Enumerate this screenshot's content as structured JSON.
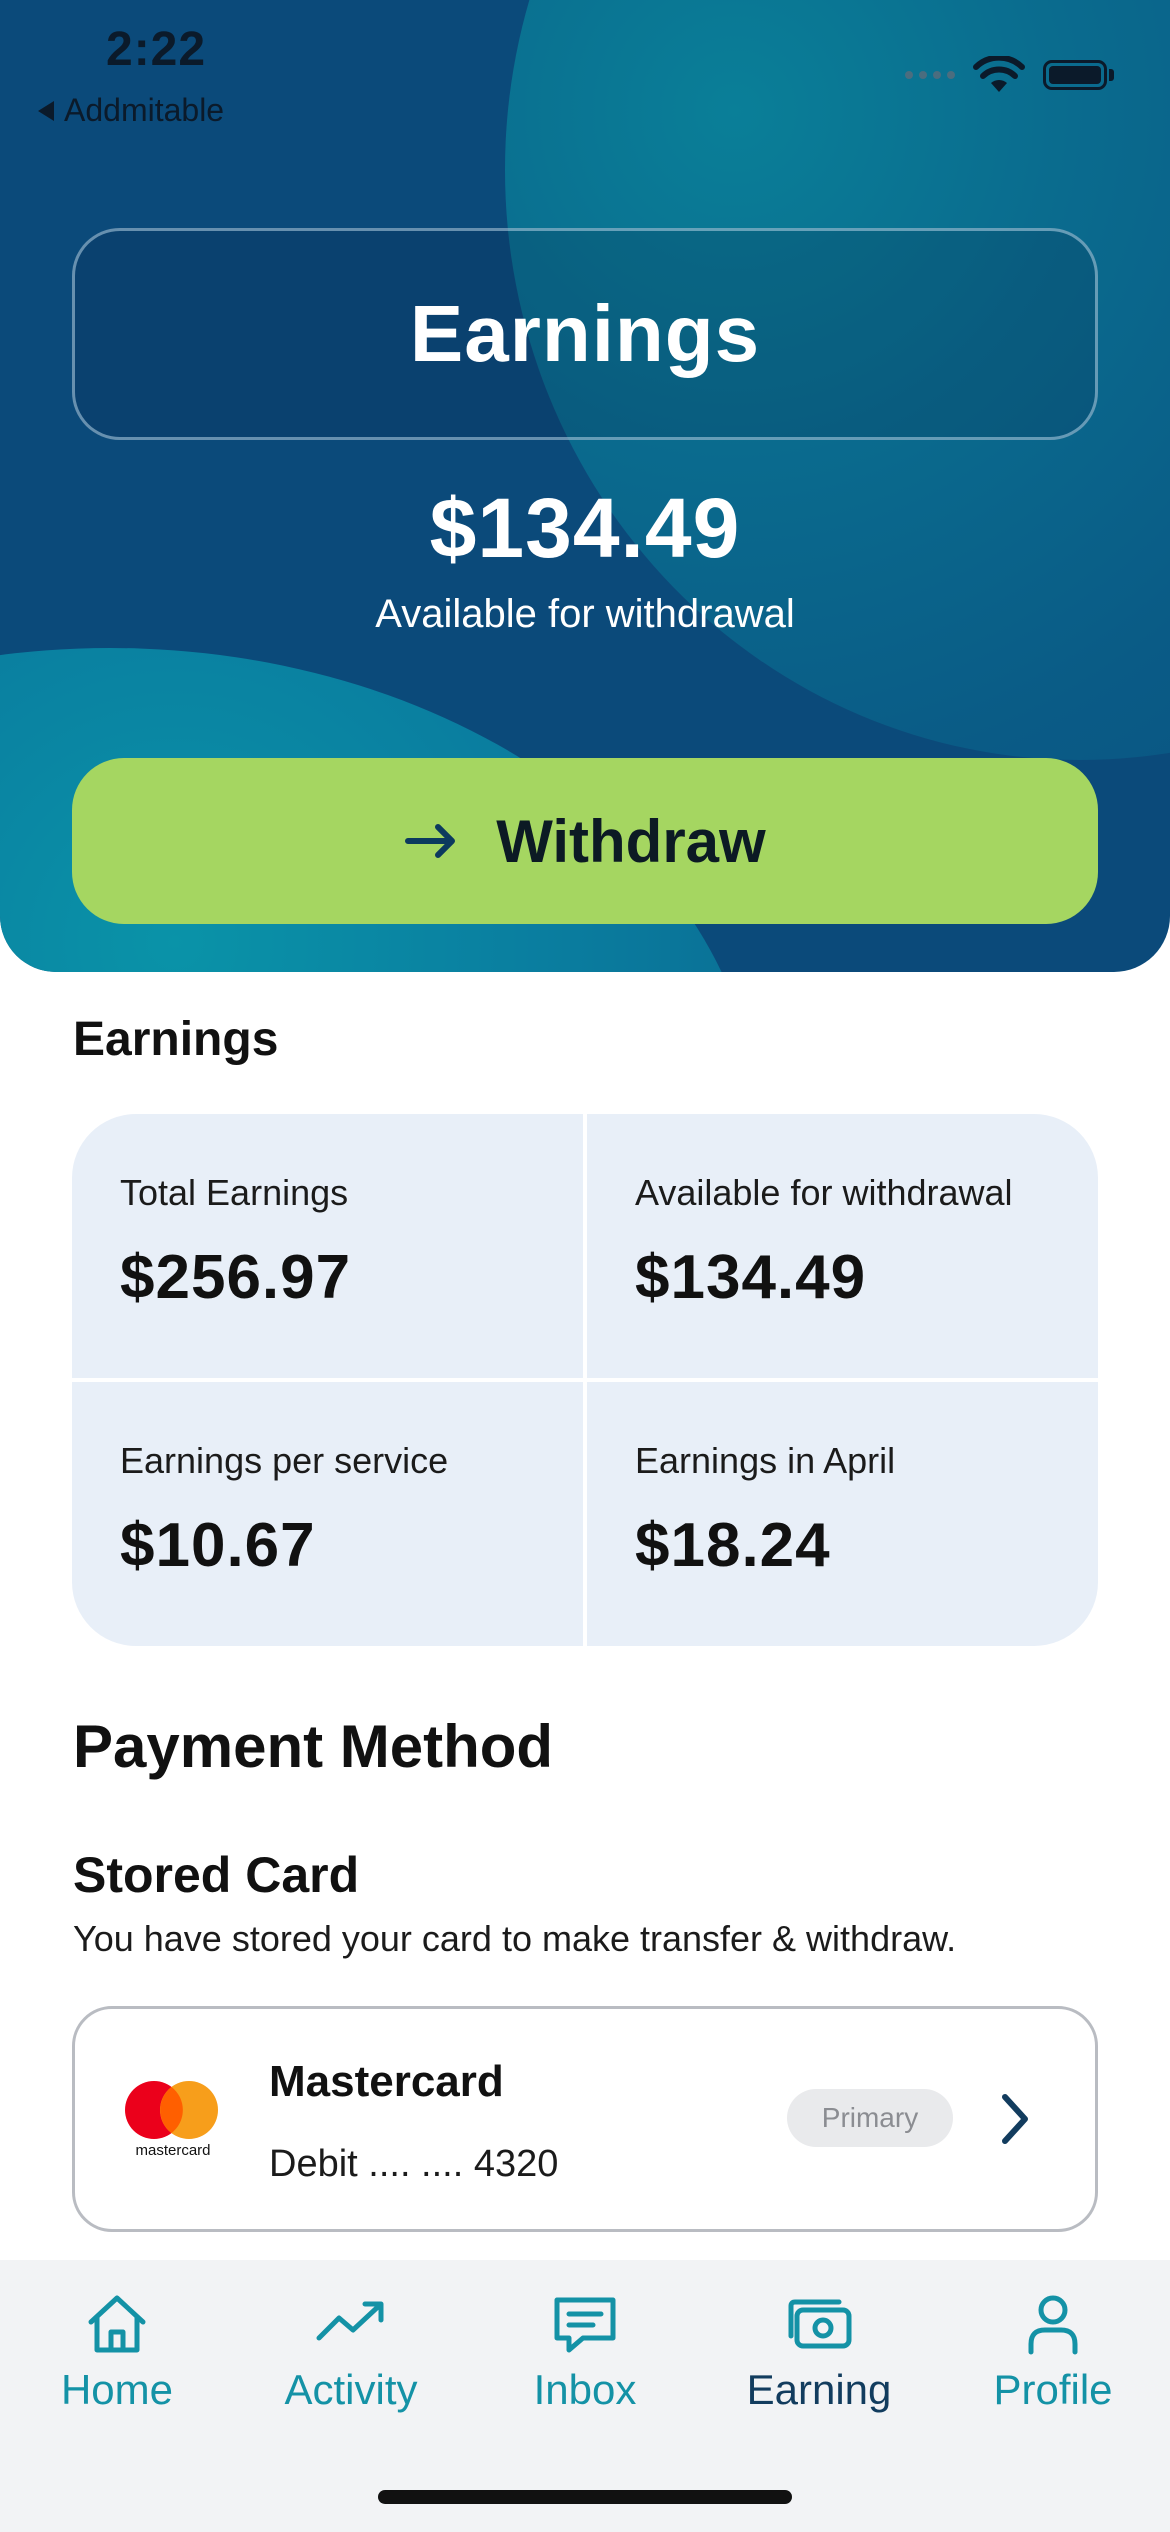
{
  "status_bar": {
    "time": "2:22",
    "back_label": "Addmitable"
  },
  "hero": {
    "title": "Earnings",
    "balance": "$134.49",
    "balance_caption": "Available for withdrawal",
    "withdraw_label": "Withdraw"
  },
  "earnings_section": {
    "title": "Earnings",
    "stats": [
      {
        "label": "Total Earnings",
        "value": "$256.97"
      },
      {
        "label": "Available for withdrawal",
        "value": "$134.49"
      },
      {
        "label": "Earnings per service",
        "value": "$10.67"
      },
      {
        "label": "Earnings in April",
        "value": "$18.24"
      }
    ]
  },
  "payment_method": {
    "title": "Payment Method",
    "stored_card_title": "Stored Card",
    "stored_card_subtitle": "You have stored your card to make transfer & withdraw.",
    "card": {
      "brand": "Mastercard",
      "logo_text": "mastercard",
      "number": "Debit .... .... 4320",
      "badge": "Primary"
    }
  },
  "tabbar": {
    "items": [
      {
        "label": "Home",
        "icon": "home-icon"
      },
      {
        "label": "Activity",
        "icon": "trending-up-icon"
      },
      {
        "label": "Inbox",
        "icon": "message-icon"
      },
      {
        "label": "Earning",
        "icon": "cash-icon",
        "active": true
      },
      {
        "label": "Profile",
        "icon": "user-icon"
      }
    ]
  },
  "colors": {
    "hero_dark": "#0b4a7a",
    "hero_teal": "#0a93a8",
    "withdraw_green": "#a5d661",
    "stat_cell_bg": "#e8eff8",
    "tab_inactive": "#1492a6",
    "tab_active": "#123c5e"
  }
}
